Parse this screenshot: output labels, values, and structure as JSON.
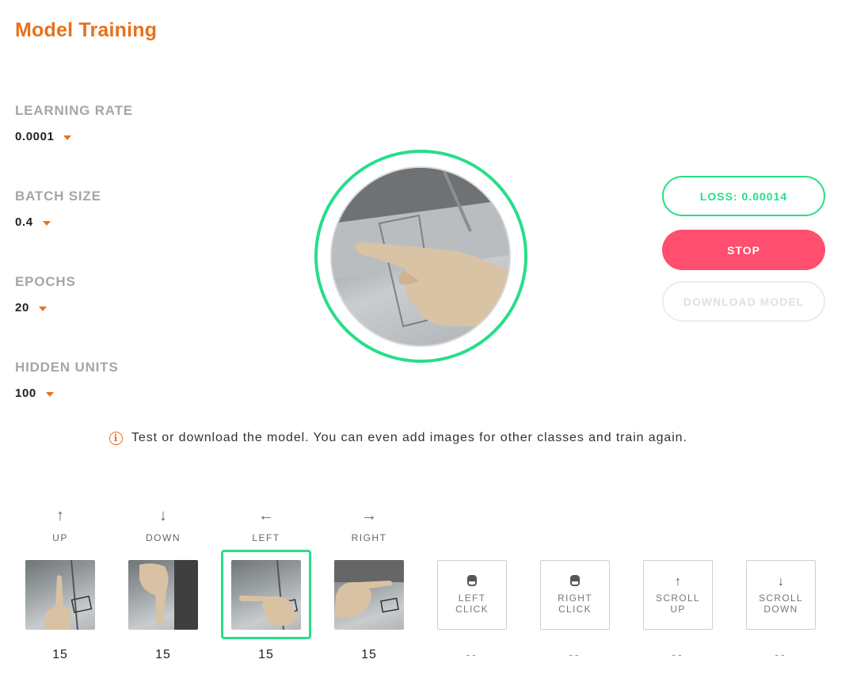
{
  "header": {
    "title": "Model Training"
  },
  "params": [
    {
      "label": "LEARNING RATE",
      "value": "0.0001"
    },
    {
      "label": "BATCH SIZE",
      "value": "0.4"
    },
    {
      "label": "EPOCHS",
      "value": "20"
    },
    {
      "label": "HIDDEN UNITS",
      "value": "100"
    }
  ],
  "buttons": {
    "loss": "LOSS: 0.00014",
    "stop": "STOP",
    "download": "DOWNLOAD MODEL"
  },
  "info": {
    "text": "Test or download the model. You can even add images for other classes and train again."
  },
  "classes": [
    {
      "arrow": "↑",
      "label": "UP",
      "count": "15"
    },
    {
      "arrow": "↓",
      "label": "DOWN",
      "count": "15"
    },
    {
      "arrow": "←",
      "label": "LEFT",
      "count": "15"
    },
    {
      "arrow": "→",
      "label": "RIGHT",
      "count": "15"
    }
  ],
  "actions": [
    {
      "icon": "mouse-left-icon",
      "label": "LEFT CLICK",
      "count": "--"
    },
    {
      "icon": "mouse-right-icon",
      "label": "RIGHT CLICK",
      "count": "--"
    },
    {
      "icon": "scroll-up-icon",
      "glyph": "↑",
      "label": "SCROLL UP",
      "count": "--"
    },
    {
      "icon": "scroll-down-icon",
      "glyph": "↓",
      "label": "SCROLL DOWN",
      "count": "--"
    }
  ],
  "colors": {
    "accent": "#e8711a",
    "success": "#27de89",
    "danger": "#ff4e6f"
  }
}
